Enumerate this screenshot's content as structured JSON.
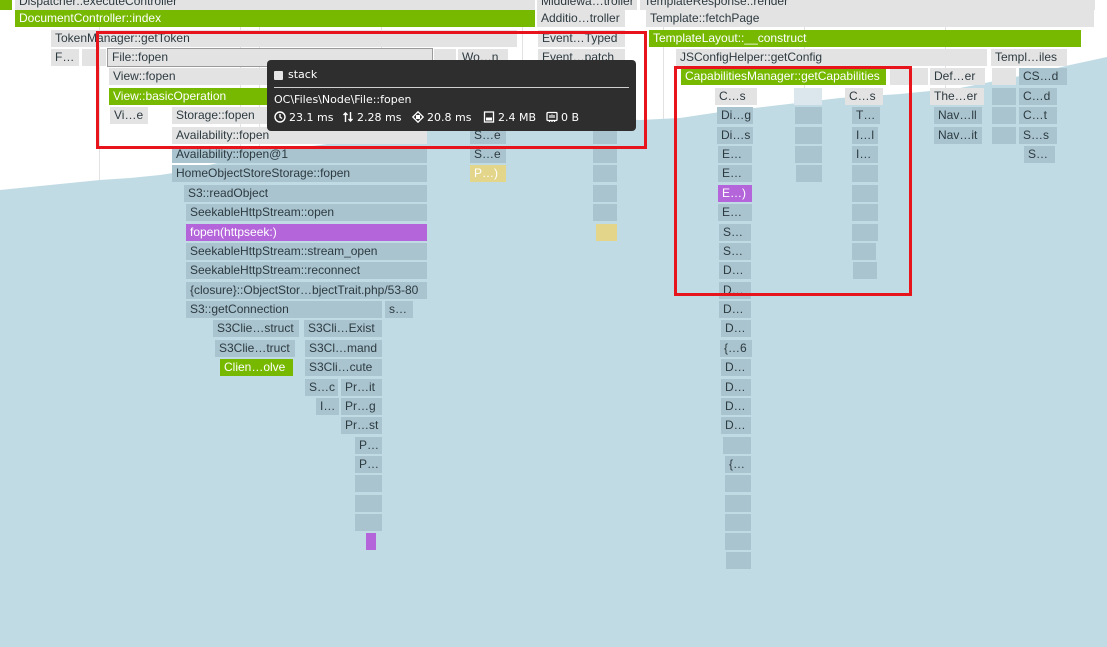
{
  "colors": {
    "background": "#ffffff",
    "area_fill": "#c0dbe4",
    "frame_default": "#e3e3e3",
    "frame_teal": "#a9c4cf",
    "frame_green": "#76b900",
    "frame_purple": "#b365d9",
    "frame_yellow": "#e3d68a",
    "highlight_box": "#e8141b",
    "tooltip_background": "#2e2e2e"
  },
  "tooltip": {
    "title": "stack",
    "path": "OC\\Files\\Node\\File::fopen",
    "stats": [
      {
        "icon": "clock-icon",
        "value": "23.1 ms"
      },
      {
        "icon": "io-arrows-icon",
        "value": "2.28 ms"
      },
      {
        "icon": "cpu-icon",
        "value": "20.8 ms"
      },
      {
        "icon": "memory-icon",
        "value": "2.4 MB"
      },
      {
        "icon": "memory-peak-icon",
        "value": "0 B"
      }
    ]
  },
  "frames": {
    "row0": [
      "Dispatcher::executeController",
      "Middlewa…troller",
      "TemplateResponse::render"
    ],
    "row1": [
      "DocumentController::index",
      "Additio…troller",
      "Template::fetchPage"
    ],
    "row2": [
      "TokenManager::getToken",
      "Event…Typed",
      "TemplateLayout::__construct"
    ],
    "row3": [
      "F…",
      "File::fopen",
      "Wo…n",
      "Event…patch",
      "JSConfigHelper::getConfig",
      "Templ…iles"
    ],
    "row4": [
      "View::fopen",
      "CapabilitiesManager::getCapabilities",
      "Def…er",
      "CS…d"
    ],
    "row5": [
      "View::basicOperation",
      "C…s",
      "C…s",
      "The…er",
      "C…d"
    ],
    "row6": [
      "Vi…e",
      "Storage::fopen",
      "Di…g",
      "T…",
      "Nav…ll",
      "C…t"
    ],
    "row7": [
      "Availability::fopen",
      "S…e",
      "Di…s",
      "I…l",
      "Nav…it",
      "S…s"
    ],
    "row8": [
      "Availability::fopen@1",
      "S…e",
      "E…",
      "I…",
      "S…"
    ],
    "row9": [
      "HomeObjectStoreStorage::fopen",
      "P…)",
      "E…"
    ],
    "row10": [
      "S3::readObject",
      "E…)"
    ],
    "row11": [
      "SeekableHttpStream::open",
      "E…"
    ],
    "row12": [
      "fopen(httpseek:)",
      "S…"
    ],
    "row13": [
      "SeekableHttpStream::stream_open",
      "S…"
    ],
    "row14": [
      "SeekableHttpStream::reconnect",
      "D…"
    ],
    "row15": [
      "{closure}::ObjectStor…bjectTrait.php/53-80",
      "D…"
    ],
    "row16": [
      "S3::getConnection",
      "s…",
      "D…"
    ],
    "row17": [
      "S3Clie…struct",
      "S3Cli…Exist",
      "D…"
    ],
    "row18": [
      "S3Clie…truct",
      "S3Cl…mand",
      "{…6"
    ],
    "row19": [
      "Clien…olve",
      "S3Cli…cute",
      "D…"
    ],
    "row20": [
      "S…c",
      "Pr…it",
      "D…"
    ],
    "row21": [
      "I…",
      "Pr…g",
      "D…"
    ],
    "row22": [
      "Pr…st",
      "D…"
    ],
    "row23": [
      "P…"
    ],
    "row24": [
      "P…",
      "{…"
    ]
  }
}
